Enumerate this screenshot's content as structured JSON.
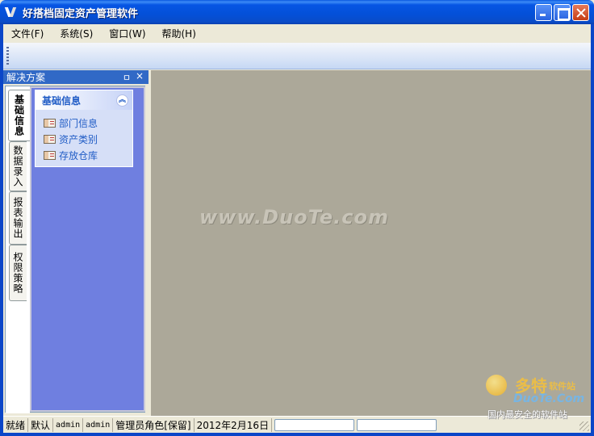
{
  "window": {
    "title": "好搭档固定资产管理软件"
  },
  "menubar": {
    "items": [
      "文件(F)",
      "系统(S)",
      "窗口(W)",
      "帮助(H)"
    ]
  },
  "panel": {
    "title": "解决方案",
    "pin_glyph": "ㅁ",
    "close_glyph": "×",
    "tabs": [
      "基础信息",
      "数据录入",
      "报表输出",
      "权限策略"
    ],
    "active_tab": "基础信息",
    "group": {
      "title": "基础信息",
      "collapse_glyph": "︽",
      "items": [
        "部门信息",
        "资产类别",
        "存放仓库"
      ]
    }
  },
  "workspace": {
    "watermark": "www.DuoTe.com"
  },
  "statusbar": {
    "status": "就绪",
    "mode": "默认",
    "user": "admin",
    "user_name": "admin",
    "role": "管理员角色[保留]",
    "date": "2012年2月16日"
  },
  "corner_logo": {
    "cn": "多特",
    "cn_sub": "软件站",
    "en": "DuoTe.Com",
    "tagline": "国内最安全的软件站"
  },
  "colors": {
    "title_bar": "#0655e4",
    "panel_header": "#3169c6",
    "tab_content": "#6f7fe0",
    "mdi_background": "#aca899",
    "link": "#215dc6"
  }
}
